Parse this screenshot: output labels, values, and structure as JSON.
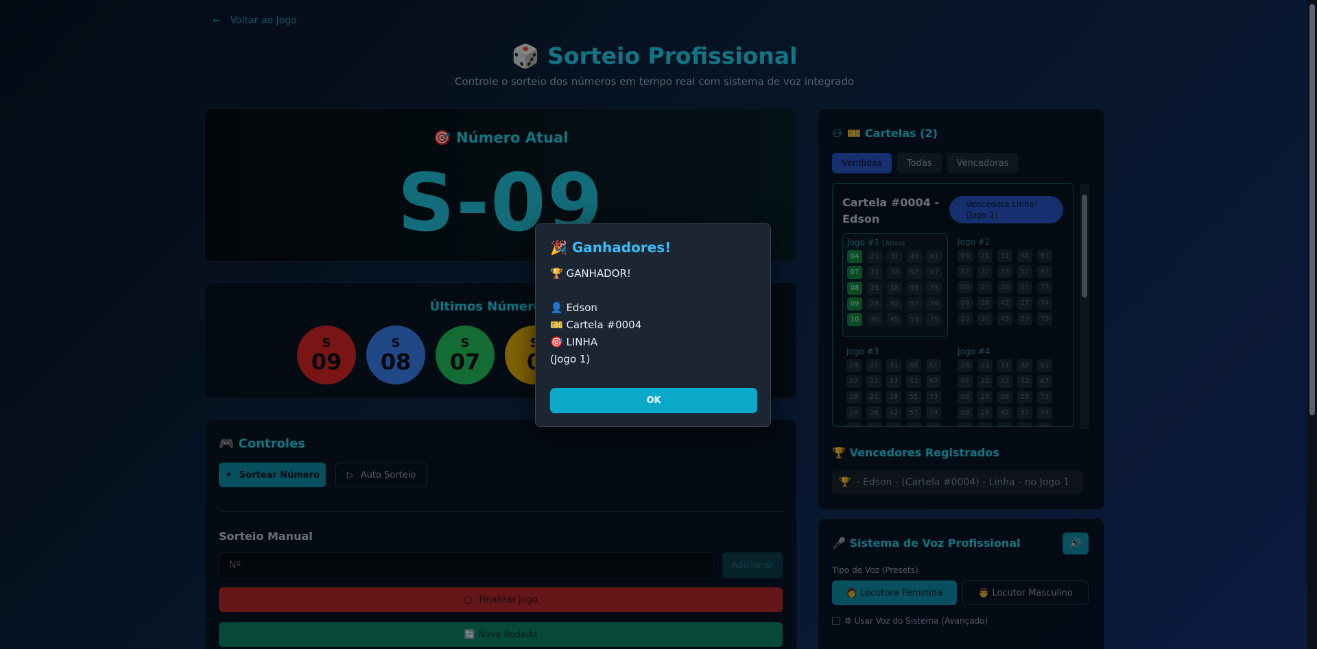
{
  "nav": {
    "back_label": "Voltar ao Jogo"
  },
  "header": {
    "title": "🎲 Sorteio Profissional",
    "subtitle": "Controle o sorteio dos números em tempo real com sistema de voz integrado"
  },
  "current": {
    "label": "🎯 Número Atual",
    "value": "S-09"
  },
  "last": {
    "label": "Últimos Números Ch",
    "balls": [
      {
        "letter": "S",
        "number": "09",
        "color": "#dc2626"
      },
      {
        "letter": "S",
        "number": "08",
        "color": "#3b82f6"
      },
      {
        "letter": "S",
        "number": "07",
        "color": "#22c55e"
      },
      {
        "letter": "S",
        "number": "0",
        "color": "#eab308"
      }
    ]
  },
  "controls": {
    "title": "🎮 Controles",
    "sortear": "Sortear Número",
    "auto": "Auto Sorteio",
    "manual_title": "Sorteio Manual",
    "manual_placeholder": "Nº",
    "add": "Adicionar",
    "finalizar": "Finalizar Jogo",
    "nova": "🔄 Nova Rodada"
  },
  "cartelas": {
    "title": "🎫 Cartelas (2)",
    "tabs": [
      "Vendidas",
      "Todas",
      "Vencedoras"
    ],
    "card_title_1": "Cartela #0004 -",
    "card_title_2": "Edson",
    "badge": "Vencedora Linha! (Jogo 1)",
    "jogos": [
      {
        "title": "Jogo #1",
        "tag": "(Ativo)"
      },
      {
        "title": "Jogo #2",
        "tag": ""
      },
      {
        "title": "Jogo #3",
        "tag": ""
      },
      {
        "title": "Jogo #4",
        "tag": ""
      }
    ],
    "grid": [
      [
        "04",
        "21",
        "31",
        "48",
        "61"
      ],
      [
        "07",
        "22",
        "33",
        "52",
        "67"
      ],
      [
        "08",
        "25",
        "38",
        "55",
        "73"
      ],
      [
        "09",
        "28",
        "42",
        "57",
        "74"
      ],
      [
        "10",
        "30",
        "45",
        "59",
        "75"
      ]
    ],
    "hits_jogo1": [
      "04",
      "07",
      "08",
      "09",
      "10"
    ]
  },
  "vencedores": {
    "title": "🏆 Vencedores Registrados",
    "item": "- Edson - (Cartela #0004) - Linha - no Jogo 1"
  },
  "voz": {
    "title": "🎤 Sistema de Voz Profissional",
    "preset_label": "Tipo de Voz (Presets)",
    "fem": "👩 Locutora Feminina",
    "mas": "👨 Locutor Masculino",
    "sistema": "⚙ Usar Voz do Sistema (Avançado)"
  },
  "dialog": {
    "title": "🎉 Ganhadores!",
    "line1": "🏆 GANHADOR!",
    "line2": "👤 Edson",
    "line3": "🎫 Cartela #0004",
    "line4": "🎯 LINHA",
    "line5": "(Jogo 1)",
    "ok": "OK"
  }
}
